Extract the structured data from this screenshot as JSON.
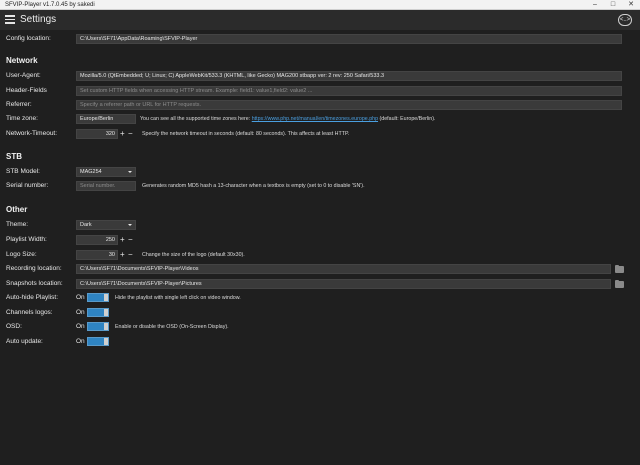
{
  "window": {
    "title": "SFVIP-Player v1.7.0.45 by sakedi"
  },
  "header": {
    "title": "Settings",
    "back_icon": "<..>"
  },
  "general": {
    "config_label": "Config location:",
    "config_value": "C:\\Users\\SF71\\AppData\\Roaming\\SFVIP-Player"
  },
  "network": {
    "heading": "Network",
    "user_agent_label": "User-Agent:",
    "user_agent_value": "Mozilla/5.0 (QtEmbedded; U; Linux; C) AppleWebKit/533.3 (KHTML, like Gecko) MAG200 stbapp ver: 2 rev: 250 Safari/533.3",
    "header_fields_label": "Header-Fields",
    "header_fields_placeholder": "Set custom HTTP fields when accessing HTTP stream. Example: field1: value1,field2: value2 ...",
    "referrer_label": "Referrer:",
    "referrer_placeholder": "Specify a referrer path or URL for HTTP requests.",
    "timezone_label": "Time zone:",
    "timezone_value": "Europe/Berlin",
    "timezone_hint_pre": "You can see all the supported time zones here:",
    "timezone_hint_link": "https://www.php.net/manual/en/timezones.europe.php",
    "timezone_hint_post": "(default: Europe/Berlin).",
    "timeout_label": "Network-Timeout:",
    "timeout_value": "320",
    "timeout_hint": "Specify the network timeout in seconds (default: 80 seconds). This affects at least HTTP."
  },
  "stb": {
    "heading": "STB",
    "model_label": "STB Model:",
    "model_value": "MAG254",
    "serial_label": "Serial number:",
    "serial_placeholder": "Serial number.",
    "serial_hint": "Generates random MD5 hash a 13-character when a textbox is empty (set to 0 to disable 'SN')."
  },
  "other": {
    "heading": "Other",
    "theme_label": "Theme:",
    "theme_value": "Dark",
    "playlist_width_label": "Playlist Width:",
    "playlist_width_value": "250",
    "logo_size_label": "Logo Size:",
    "logo_size_value": "30",
    "logo_size_hint": "Change the size of the logo (default 30x30).",
    "recording_label": "Recording location:",
    "recording_value": "C:\\Users\\SF71\\Documents\\SFVIP-Player\\Videos",
    "snapshots_label": "Snapshots location:",
    "snapshots_value": "C:\\Users\\SF71\\Documents\\SFVIP-Player\\Pictures",
    "autohide_label": "Auto-hide Playlist:",
    "autohide_state": "On",
    "autohide_hint": "Hide the playlist with single left click on video window.",
    "channel_logos_label": "Channels logos:",
    "channel_logos_state": "On",
    "osd_label": "OSD:",
    "osd_state": "On",
    "osd_hint": "Enable or disable the OSD (On-Screen Display).",
    "autoupdate_label": "Auto update:",
    "autoupdate_state": "On"
  },
  "stepper": {
    "plus": "+",
    "minus": "−"
  },
  "colors": {
    "accent": "#2f84c2",
    "background": "#1f1f1f",
    "link": "#4a9fe0"
  }
}
